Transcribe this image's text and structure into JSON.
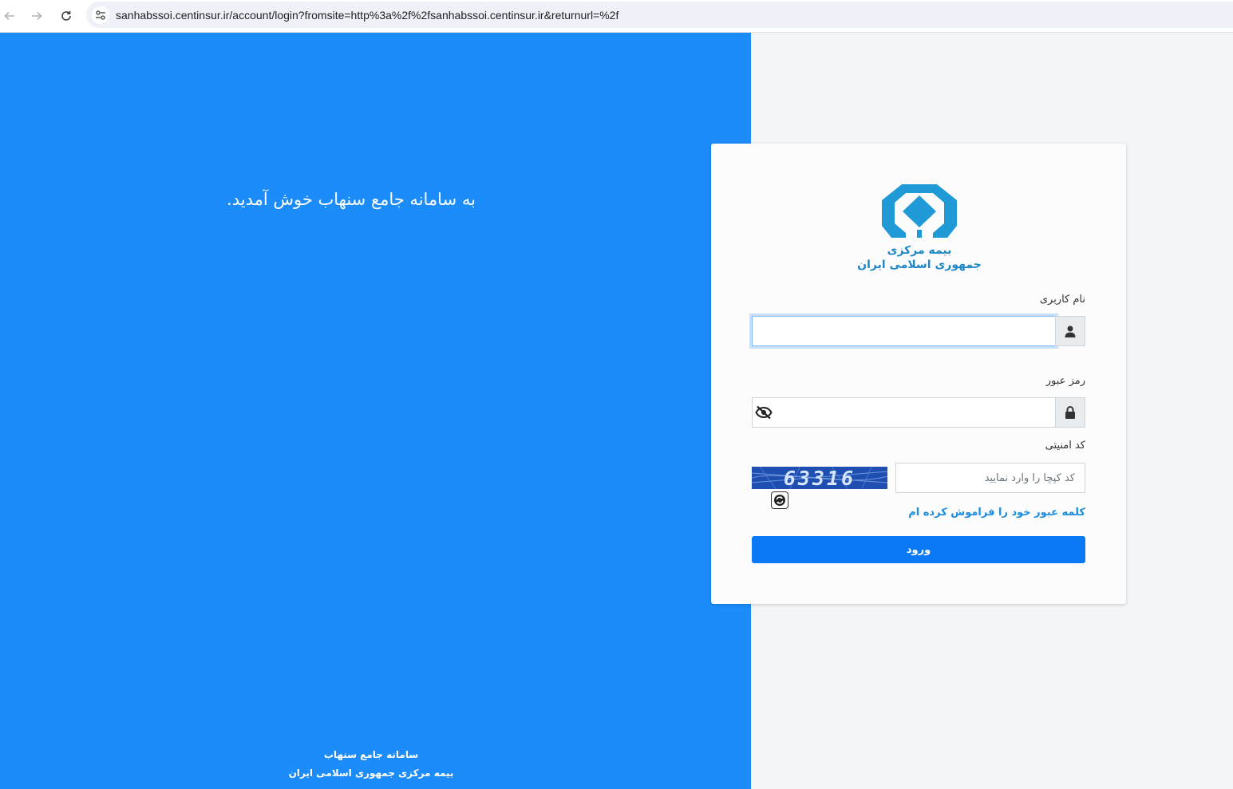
{
  "browser": {
    "url": "sanhabssoi.centinsur.ir/account/login?fromsite=http%3a%2f%2fsanhabssoi.centinsur.ir&returnurl=%2f",
    "back_icon": "arrow-left-icon",
    "forward_icon": "arrow-right-icon",
    "reload_icon": "reload-icon",
    "site_info_icon": "tune-icon"
  },
  "left_panel": {
    "welcome": "به سامانه جامع سنهاب خوش آمدید.",
    "footer_line1": "سامانه جامع سنهاب",
    "footer_line2": "بیمه مرکزی جمهوری اسلامی ایران",
    "background_color": "#1c8cfb"
  },
  "logo": {
    "line1": "بیمه مرکزی",
    "line2": "جمهوری اسلامی ایران",
    "color": "#1f86c6"
  },
  "form": {
    "username_label": "نام کاربری",
    "username_value": "",
    "username_icon": "user-icon",
    "password_label": "رمز عبور",
    "password_value": "",
    "password_icon": "lock-icon",
    "password_toggle_icon": "eye-slash-icon",
    "captcha_label": "کد امنیتی",
    "captcha_code": "63316",
    "captcha_placeholder": "کد کپچا را وارد نمایید",
    "refresh_icon": "refresh-icon",
    "forgot_link": "کلمه عبور خود را فراموش کرده ام",
    "submit_label": "ورود",
    "accent_color": "#0b79f5"
  }
}
